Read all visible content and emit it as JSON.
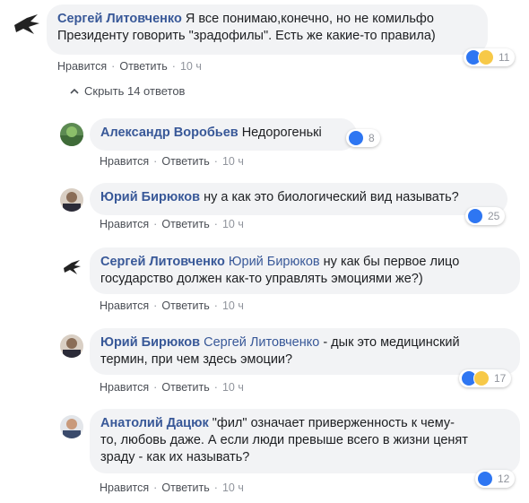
{
  "main_comment": {
    "author": "Сергей Литовченко",
    "text_line1": "Я все понимаю,конечно, но не комильфо",
    "text_line2": "Президенту говорить \"зрадофилы\". Есть же какие-то правила)",
    "like_label": "Нравится",
    "reply_label": "Ответить",
    "time": "10 ч",
    "reaction_count": "11",
    "reactions": [
      "like-icon",
      "haha-icon"
    ]
  },
  "hide_replies": {
    "label": "Скрыть 14 ответов"
  },
  "replies": [
    {
      "author": "Александр Воробьев",
      "text_line1": "Недорогенькі",
      "like_label": "Нравится",
      "reply_label": "Ответить",
      "time": "10 ч",
      "reaction_count": "8",
      "reactions": [
        "like-icon"
      ]
    },
    {
      "author": "Юрий Бирюков",
      "text_line1": "ну а как это биологический вид называть?",
      "like_label": "Нравится",
      "reply_label": "Ответить",
      "time": "10 ч",
      "reaction_count": "25",
      "reactions": [
        "like-icon"
      ]
    },
    {
      "author": "Сергей Литовченко",
      "mention": "Юрий Бирюков",
      "text_line1": "ну как бы первое лицо",
      "text_line2": "государство должен как-то управлять эмоциями же?)",
      "like_label": "Нравится",
      "reply_label": "Ответить",
      "time": "10 ч"
    },
    {
      "author": "Юрий Бирюков",
      "mention": "Сергей Литовченко",
      "text_line1": "- дык это медицинский",
      "text_line2": "термин, при чем здесь эмоции?",
      "like_label": "Нравится",
      "reply_label": "Ответить",
      "time": "10 ч",
      "reaction_count": "17",
      "reactions": [
        "like-icon",
        "haha-icon"
      ]
    },
    {
      "author": "Анатолий Дацюк",
      "text_line1": "\"фил\" означает приверженность к чему-",
      "text_line2": "то, любовь даже. А если люди превыше всего в жизни ценят",
      "text_line3": "зраду - как их называть?",
      "like_label": "Нравится",
      "reply_label": "Ответить",
      "time": "10 ч",
      "reaction_count": "12",
      "reactions": [
        "like-icon"
      ]
    }
  ]
}
